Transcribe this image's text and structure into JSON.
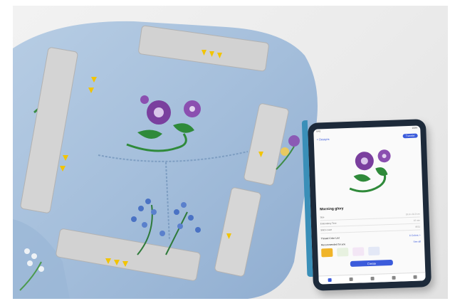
{
  "scene": {
    "subject": "denim-jacket-in-embroidery-hoop",
    "colors": {
      "denim": "#a9c2dd",
      "denim_dark": "#7e9ec2",
      "hoop": "#cfcfcf",
      "hoop_edge": "#b2b2b2",
      "flower_purple": "#7a3f9e",
      "leaf_green": "#2f8a3a",
      "blue_flowers": "#4a72c4",
      "warning_yellow": "#f2c400"
    }
  },
  "tablet": {
    "status_time": "9:41",
    "status_battery": "100%",
    "back_label": "< Designs",
    "action_label": "Transfer",
    "design_name": "Morning glory",
    "rows": [
      {
        "label": "Size",
        "value": "10.0 x 10.0 cm"
      },
      {
        "label": "Embroidery Time",
        "value": "16 min"
      },
      {
        "label": "Stitch count",
        "value": "8531"
      }
    ],
    "thread_row": {
      "label": "Thread Color List",
      "link": "6 Colors >"
    },
    "recommended_row": {
      "label": "Recommended for you",
      "link": "See all"
    },
    "create_label": "Create"
  }
}
